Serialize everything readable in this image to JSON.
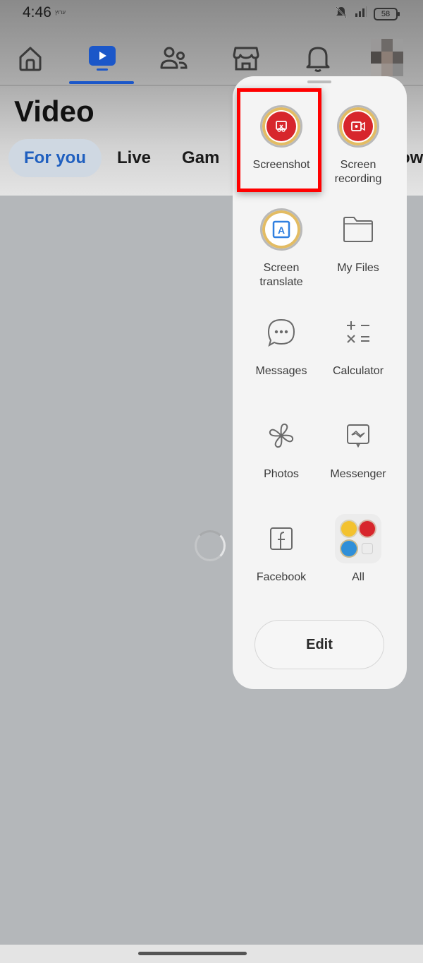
{
  "status_bar": {
    "time": "4:46",
    "carrier": "ערוץ",
    "battery": "58",
    "icons": [
      "bell-off-icon",
      "signal-icon",
      "battery-icon"
    ]
  },
  "nav": {
    "items": [
      {
        "name": "home",
        "icon": "home-icon",
        "active": false
      },
      {
        "name": "video",
        "icon": "video-icon",
        "active": true
      },
      {
        "name": "friends",
        "icon": "friends-icon",
        "active": false
      },
      {
        "name": "marketplace",
        "icon": "marketplace-icon",
        "active": false
      },
      {
        "name": "notifications",
        "icon": "bell-icon",
        "active": false
      },
      {
        "name": "profile",
        "icon": "avatar",
        "active": false
      }
    ],
    "accent": "#1b57c9"
  },
  "page": {
    "title": "Video",
    "tabs": [
      {
        "label": "For you",
        "active": true
      },
      {
        "label": "Live",
        "active": false
      },
      {
        "label": "Gam",
        "active": false
      }
    ],
    "tab_overflow": "ow"
  },
  "panel": {
    "apps": [
      {
        "label": "Screenshot",
        "icon": "screenshot-icon",
        "highlighted": true
      },
      {
        "label": "Screen\nrecording",
        "icon": "screen-recording-icon"
      },
      {
        "label": "Screen\ntranslate",
        "icon": "screen-translate-icon"
      },
      {
        "label": "My Files",
        "icon": "folder-icon"
      },
      {
        "label": "Messages",
        "icon": "messages-icon"
      },
      {
        "label": "Calculator",
        "icon": "calculator-icon"
      },
      {
        "label": "Photos",
        "icon": "photos-icon"
      },
      {
        "label": "Messenger",
        "icon": "messenger-icon"
      },
      {
        "label": "Facebook",
        "icon": "facebook-icon"
      },
      {
        "label": "All",
        "icon": "all-apps-icon"
      }
    ],
    "edit_label": "Edit",
    "highlight_color": "#ff0000"
  }
}
